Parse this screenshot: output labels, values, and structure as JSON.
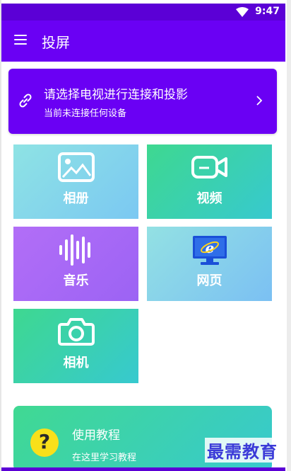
{
  "status_bar": {
    "time": "9:47",
    "wifi_icon": "wifi-icon"
  },
  "app_bar": {
    "menu_icon": "menu-icon",
    "title": "投屏"
  },
  "connect_card": {
    "icon": "link-icon",
    "title": "请选择电视进行连接和投影",
    "subtitle": "当前未连接任何设备",
    "chevron": "chevron-right-icon"
  },
  "tiles": [
    {
      "label": "相册",
      "icon": "image-icon"
    },
    {
      "label": "视频",
      "icon": "video-camera-icon"
    },
    {
      "label": "音乐",
      "icon": "audio-wave-icon"
    },
    {
      "label": "网页",
      "icon": "browser-monitor-icon"
    },
    {
      "label": "相机",
      "icon": "camera-icon"
    }
  ],
  "tutorial_card": {
    "icon": "help-icon",
    "title": "使用教程",
    "subtitle": "在这里学习教程"
  },
  "watermark": "最需教育",
  "colors": {
    "primary": "#6a00f4",
    "status_bar": "#5b00d6",
    "help_yellow": "#f9e01a"
  }
}
